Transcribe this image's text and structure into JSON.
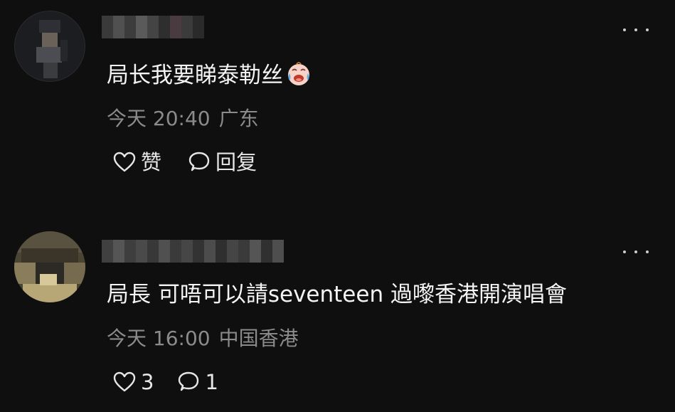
{
  "comments": [
    {
      "text": "局长我要睇泰勒丝",
      "emoji": "loudly-crying-face",
      "time": "今天 20:40",
      "location": "广东",
      "like_label": "赞",
      "reply_label": "回复"
    },
    {
      "text": "局長 可唔可以請seventeen 過嚟香港開演唱會",
      "time": "今天 16:00",
      "location": "中国香港",
      "like_label": "3",
      "reply_label": "1"
    }
  ],
  "colors": {
    "background": "#0f0f0f",
    "text": "#f4f4f4",
    "meta": "#8b8b8b"
  }
}
